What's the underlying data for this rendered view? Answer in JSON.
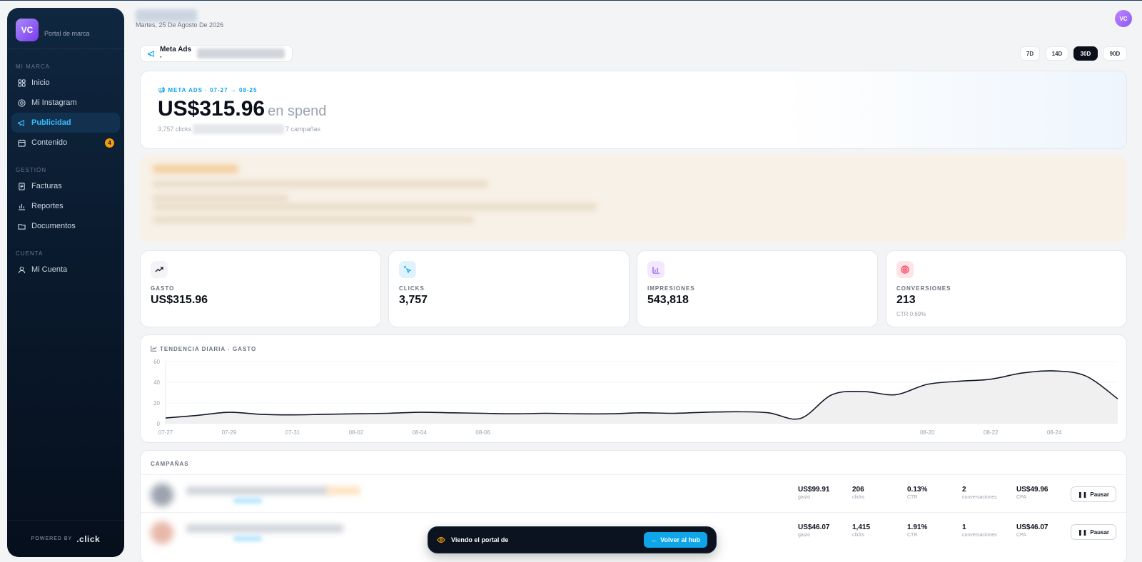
{
  "sidebar": {
    "brand_initials": "VC",
    "brand_subtitle": "Portal de marca",
    "sections": [
      {
        "label": "MI MARCA"
      },
      {
        "label": "GESTIÓN"
      },
      {
        "label": "CUENTA"
      }
    ],
    "items": [
      {
        "label": "Inicio"
      },
      {
        "label": "Mi Instagram"
      },
      {
        "label": "Publicidad"
      },
      {
        "label": "Contenido",
        "badge": "4"
      },
      {
        "label": "Facturas"
      },
      {
        "label": "Reportes"
      },
      {
        "label": "Documentos"
      },
      {
        "label": "Mi Cuenta"
      }
    ],
    "powered_by": "POWERED BY",
    "powered_logo": ".click"
  },
  "header": {
    "date": "Martes, 25 De Agosto De 2026",
    "user_initials": "VC"
  },
  "source_chip": {
    "label": "Meta Ads ·"
  },
  "ranges": [
    {
      "label": "7D"
    },
    {
      "label": "14D"
    },
    {
      "label": "30D",
      "active": true
    },
    {
      "label": "90D"
    }
  ],
  "hero": {
    "kicker": "META ADS · 07-27 → 08-25",
    "amount": "US$315.96",
    "amount_suffix": "en spend",
    "meta_left": "3,757 clicks",
    "meta_right": "7 campañas"
  },
  "kpis": [
    {
      "label": "GASTO",
      "value": "US$315.96",
      "icon": "trend-up-icon"
    },
    {
      "label": "CLICKS",
      "value": "3,757",
      "icon": "cursor-click-icon"
    },
    {
      "label": "IMPRESIONES",
      "value": "543,818",
      "icon": "bar-chart-icon"
    },
    {
      "label": "CONVERSIONES",
      "value": "213",
      "sub": "CTR 0.69%",
      "icon": "target-icon"
    }
  ],
  "chart_data": {
    "type": "area",
    "title": "TENDENCIA DIARIA · GASTO",
    "x": [
      "07-27",
      "07-28",
      "07-29",
      "07-30",
      "07-31",
      "08-01",
      "08-02",
      "08-03",
      "08-04",
      "08-05",
      "08-06",
      "08-07",
      "08-08",
      "08-09",
      "08-10",
      "08-11",
      "08-12",
      "08-13",
      "08-14",
      "08-15",
      "08-16",
      "08-17",
      "08-18",
      "08-19",
      "08-20",
      "08-21",
      "08-22",
      "08-23",
      "08-24",
      "08-25",
      "08-26"
    ],
    "values": [
      5.5,
      8,
      11,
      9,
      8.5,
      9,
      9.5,
      10,
      11,
      10.5,
      10,
      9.5,
      10,
      9.5,
      9.5,
      10.5,
      10,
      11,
      11.5,
      10.5,
      5,
      28,
      31,
      28,
      38,
      41,
      43,
      49,
      51,
      46,
      24
    ],
    "x_tick_labels": [
      "07-27",
      "07-29",
      "07-31",
      "08-02",
      "08-04",
      "08-06",
      "08-20",
      "08-22",
      "08-24"
    ],
    "y_ticks": [
      0,
      20,
      40,
      60
    ],
    "ylim": [
      0,
      60
    ],
    "colors": {
      "line": "#111827",
      "fill": "#f0f0f0"
    }
  },
  "campaigns": {
    "title": "CAMPAÑAS",
    "rows": [
      {
        "spend": "US$99.91",
        "spend_label": "gasto",
        "clicks": "206",
        "clicks_label": "clicks",
        "ctr": "0.13%",
        "ctr_label": "CTR",
        "conv": "2",
        "conv_label": "conversaciones",
        "cpa": "US$49.96",
        "cpa_label": "CPA",
        "action": "Pausar"
      },
      {
        "spend": "US$46.07",
        "spend_label": "gasto",
        "clicks": "1,415",
        "clicks_label": "clicks",
        "ctr": "1.91%",
        "ctr_label": "CTR",
        "conv": "1",
        "conv_label": "conversaciones",
        "cpa": "US$46.07",
        "cpa_label": "CPA",
        "action": "Pausar"
      }
    ]
  },
  "viewbar": {
    "text": "Viendo el portal de",
    "button": "Volver al hub"
  }
}
